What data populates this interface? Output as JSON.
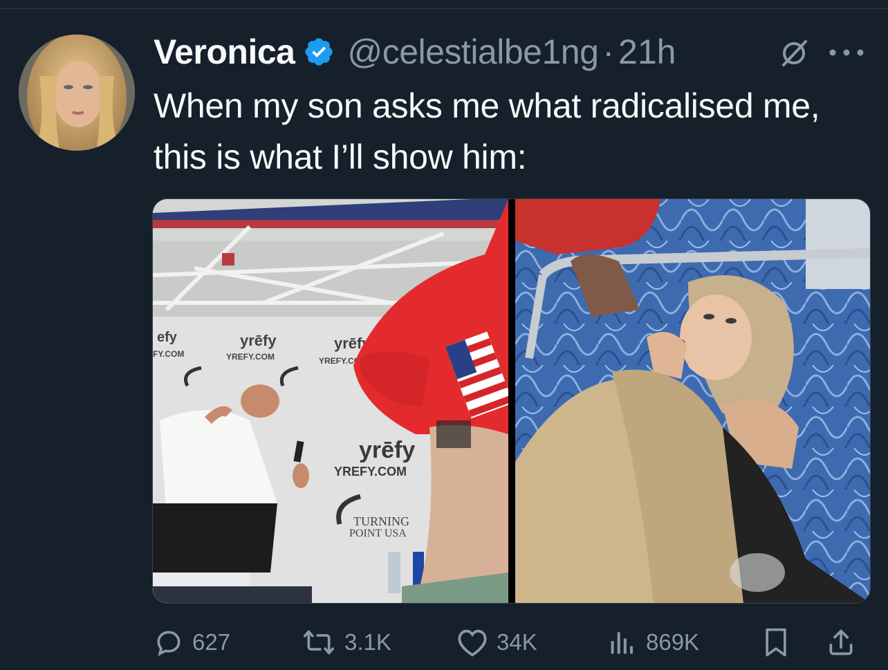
{
  "tweet": {
    "author_name": "Veronica",
    "handle": "@celestialbe1ng",
    "separator": "·",
    "time": "21h",
    "text": "When my son asks me what radicalised me, this is what I’ll show him:"
  },
  "media": {
    "left_image_signs": {
      "brand_1": "yrēfy",
      "brand_url_1": "YREFY.COM",
      "brand_2": "yrēfy",
      "brand_url_2": "YREFY.CO",
      "brand_3": "yrēfy",
      "brand_url_3": "YREFY.COM",
      "tpusa_1": "TURNING",
      "tpusa_2": "POINT USA",
      "partial_left": "efy",
      "partial_left_url": "FY.COM"
    }
  },
  "actions": {
    "replies": "627",
    "reposts": "3.1K",
    "likes": "34K",
    "views": "869K"
  },
  "colors": {
    "background": "#15202b",
    "text_primary": "#f7f9f9",
    "text_secondary": "#8b98a5",
    "verified_blue": "#1d9bf0"
  },
  "icons": [
    "verified-badge-icon",
    "grok-icon",
    "more-icon",
    "reply-icon",
    "repost-icon",
    "like-icon",
    "views-icon",
    "bookmark-icon",
    "share-icon"
  ]
}
